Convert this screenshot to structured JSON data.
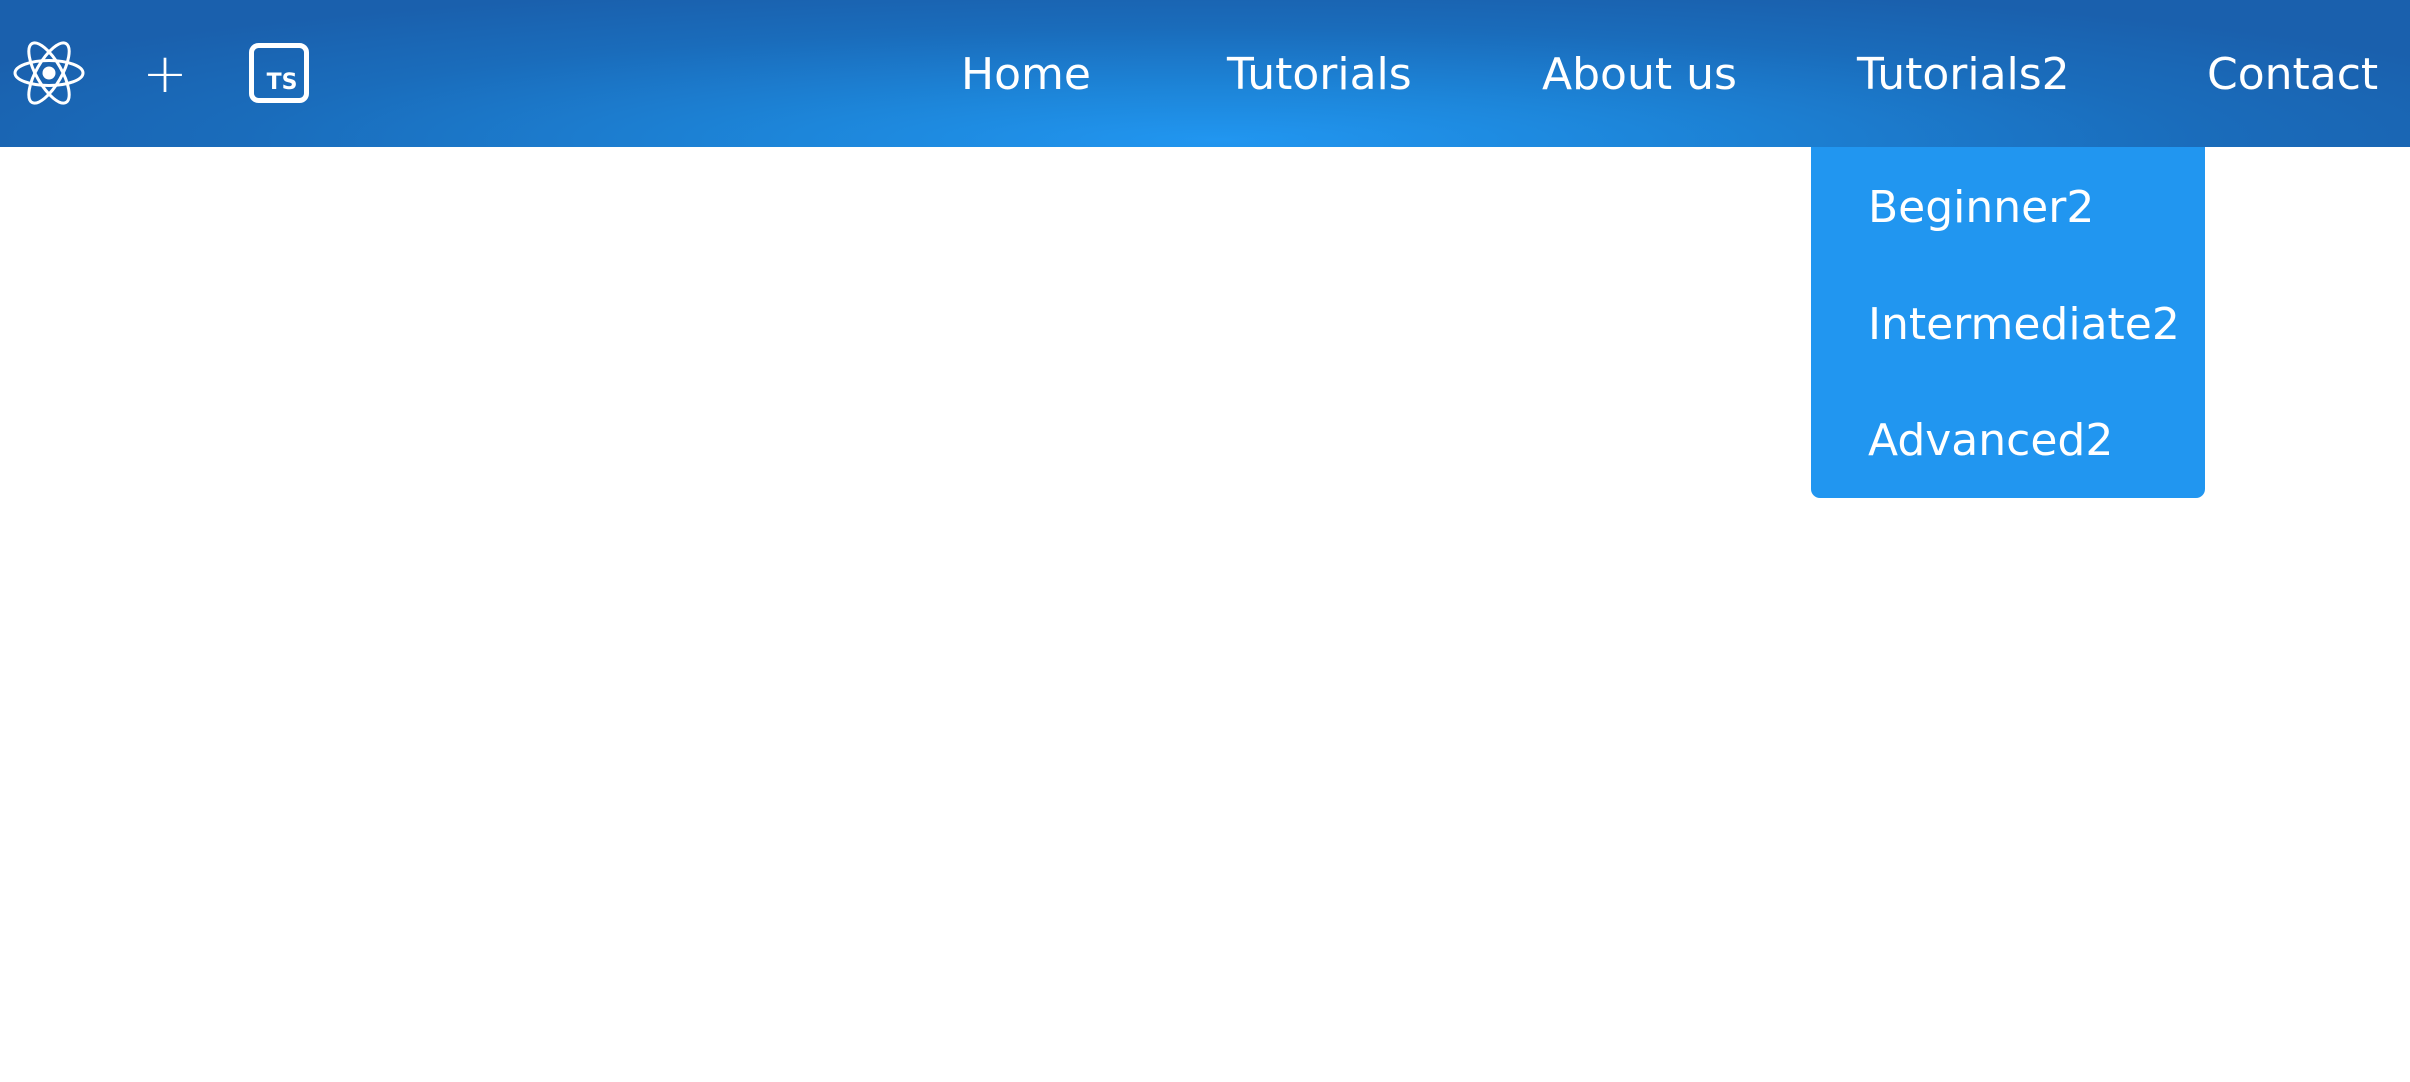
{
  "colors": {
    "navbar_gradient_dark": "#1a60ad",
    "navbar_gradient_light": "#2196f0",
    "dropdown_background": "#2196f0",
    "text": "#ffffff",
    "page_background": "#ffffff"
  },
  "header": {
    "icons": [
      {
        "name": "react-logo-icon"
      },
      {
        "name": "plus-icon",
        "glyph": "+"
      },
      {
        "name": "typescript-logo-icon",
        "glyph": "TS"
      }
    ],
    "nav": [
      {
        "label": "Home"
      },
      {
        "label": "Tutorials"
      },
      {
        "label": "About us"
      },
      {
        "label": "Tutorials2"
      },
      {
        "label": "Contact"
      }
    ]
  },
  "dropdown": {
    "items": [
      {
        "label": "Beginner2"
      },
      {
        "label": "Intermediate2"
      },
      {
        "label": "Advanced2"
      }
    ]
  }
}
